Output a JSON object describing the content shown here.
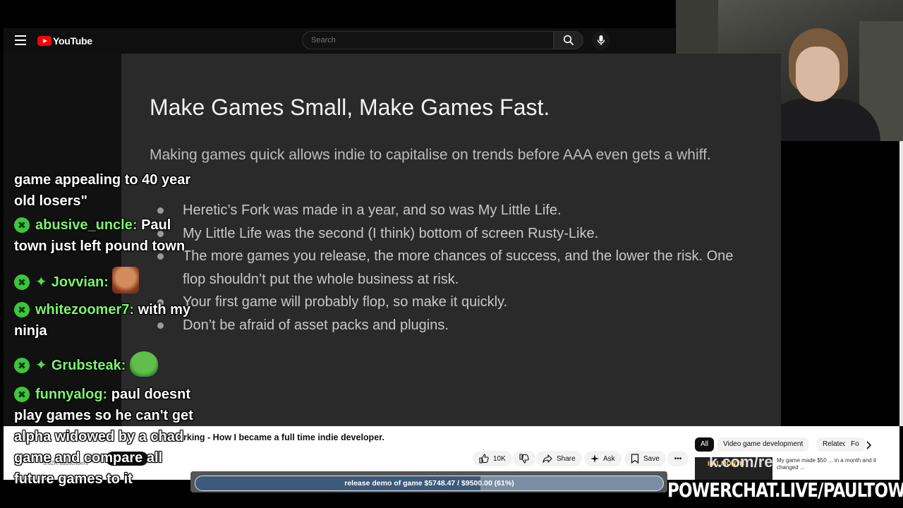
{
  "youtube": {
    "logo_text": "YouTube",
    "search_placeholder": "Search",
    "brand_color": "#ff0000"
  },
  "slide": {
    "title": "Make Games Small, Make Games Fast.",
    "subtitle": "Making games quick allows indie to capitalise on trends before AAA even gets a whiff.",
    "bullets": [
      "Heretic’s Fork was made in a year, and so was My Little Life.",
      "My Little Life was the second (I think) bottom of screen Rusty-Like.",
      "The more games you release, the more chances of success, and the lower the risk. One flop shouldn’t put the whole business at risk.",
      "Your first game will probably flop, so make it quickly.",
      "Don’t be afraid of asset packs and plugins."
    ]
  },
  "chat": {
    "messages": [
      {
        "user": "",
        "text": "game appealing to 40 year old losers\"",
        "emote": ""
      },
      {
        "user": "abusive_uncle:",
        "text": "Paul town just left pound town",
        "emote": ""
      },
      {
        "user": "Jovvian:",
        "text": "",
        "emote": "face-emote"
      },
      {
        "user": "whitezoomer7:",
        "text": "with my ninja",
        "emote": ""
      },
      {
        "user": "Grubsteak:",
        "text": "",
        "emote": "pepe-emote"
      },
      {
        "user": "funnyalog:",
        "text": "paul doesnt play games so he can't get alpha widowed by a chad game and compare all future games to it",
        "emote": ""
      }
    ],
    "badge_glyph": "✖",
    "star_glyph": "✦",
    "username_color": "#7cf56e"
  },
  "video_info": {
    "title_partial": "rking - How I became a full time indie developer.",
    "subscribers": "5.62K subscribers",
    "likes": "10K",
    "share_label": "Share",
    "ask_label": "Ask",
    "save_label": "Save",
    "more_label": "•••"
  },
  "chips": [
    "All",
    "Video game development",
    "Related",
    "Fo"
  ],
  "related": {
    "thumb_text": "IN 1 MONTH",
    "overlay_text": "k.com/re",
    "meta": "My game made $50 ... in a month and it changed ..."
  },
  "donation_goal": {
    "text": "release demo of game $5748.47 / $9500.00 (61%)",
    "progress": 0.61,
    "current": 5748.47,
    "target": 9500.0
  },
  "watermark": "POWERCHAT.LIVE/PAULTOWN"
}
